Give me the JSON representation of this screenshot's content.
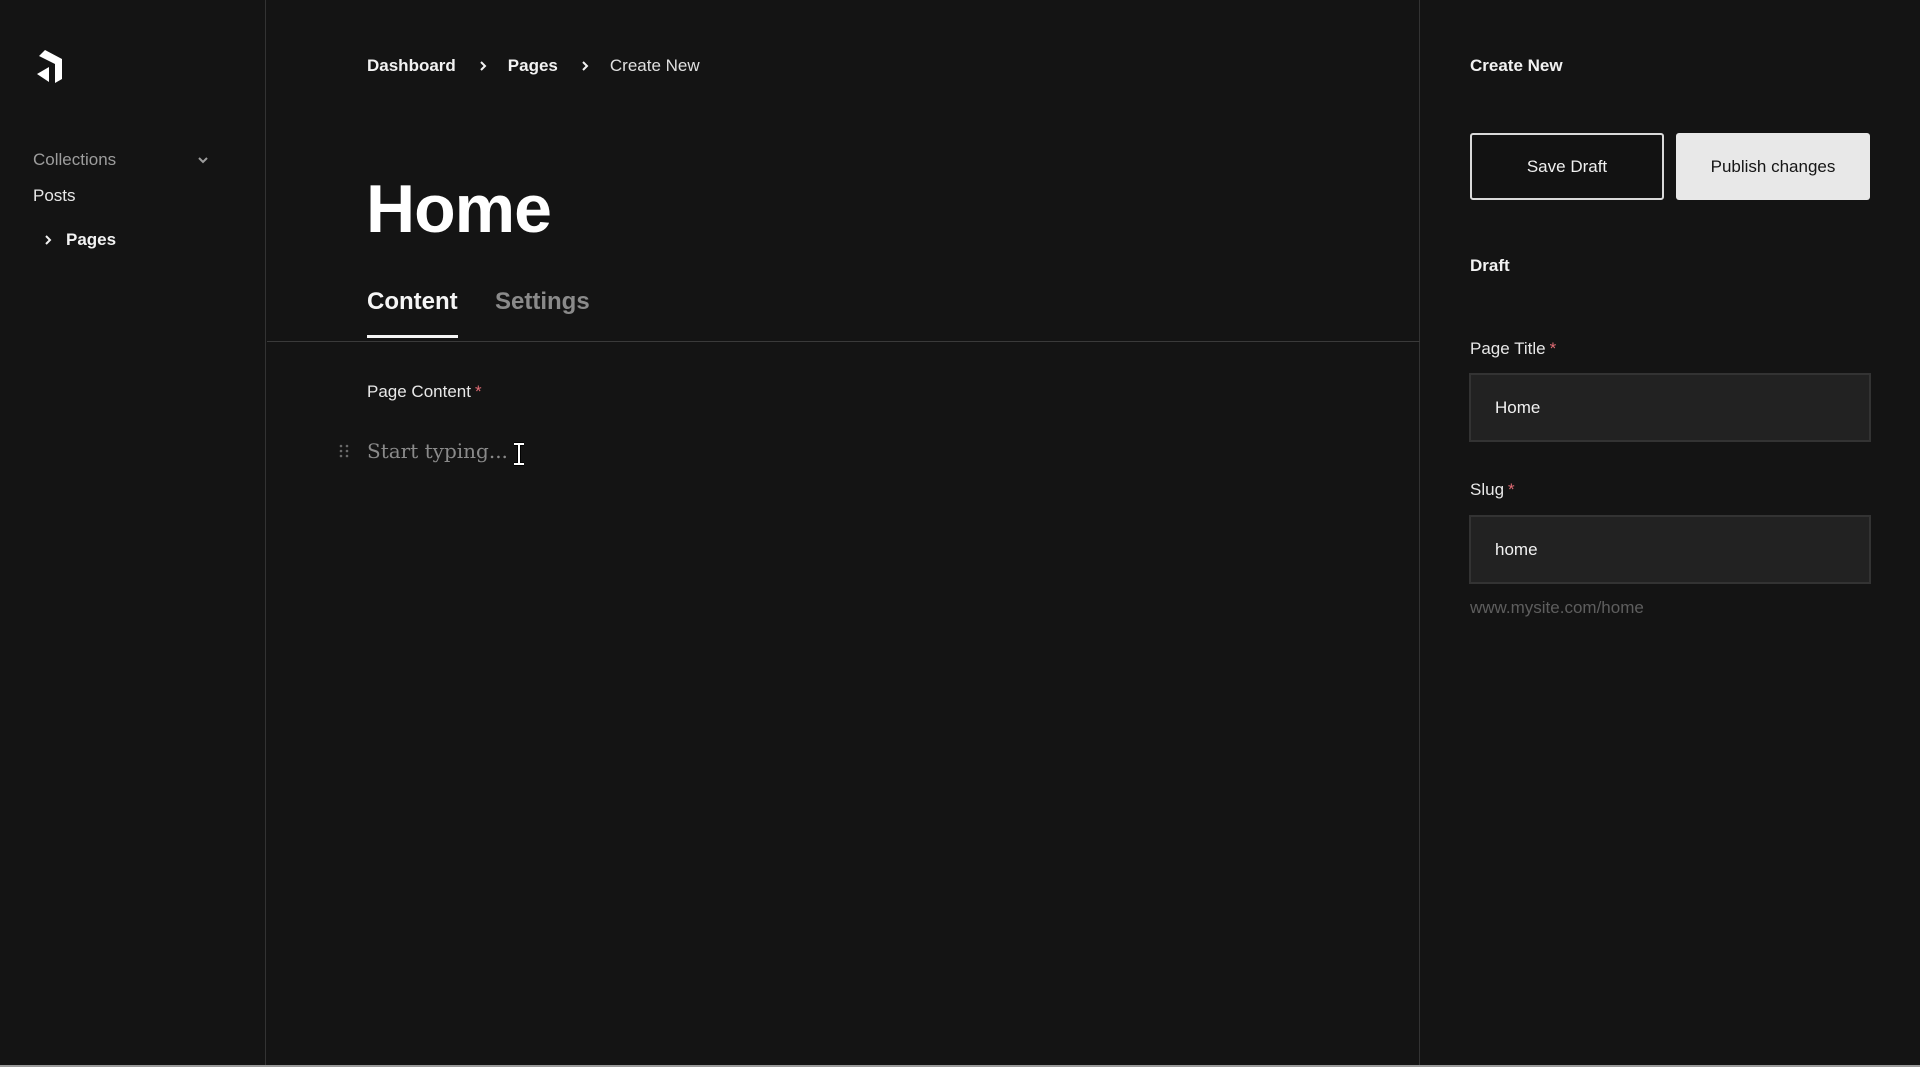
{
  "sidebar": {
    "logo": "payload-logo-icon",
    "collections_label": "Collections",
    "items": [
      {
        "label": "Posts",
        "active": false
      },
      {
        "label": "Pages",
        "active": true
      }
    ]
  },
  "breadcrumb": {
    "items": [
      "Dashboard",
      "Pages",
      "Create New"
    ]
  },
  "main": {
    "page_title": "Home",
    "tabs": [
      {
        "label": "Content",
        "active": true
      },
      {
        "label": "Settings",
        "active": false
      }
    ],
    "content_field": {
      "label": "Page Content",
      "required_marker": "*",
      "placeholder": "Start typing..."
    }
  },
  "panel": {
    "title": "Create New",
    "save_draft_label": "Save Draft",
    "publish_label": "Publish changes",
    "status": "Draft",
    "fields": {
      "page_title": {
        "label": "Page Title",
        "required_marker": "*",
        "value": "Home"
      },
      "slug": {
        "label": "Slug",
        "required_marker": "*",
        "value": "home",
        "hint": "www.mysite.com/home"
      }
    }
  },
  "colors": {
    "background": "#141414",
    "required": "#e06c75",
    "publish_button": "#e8e8e8",
    "input_bg": "#222222"
  }
}
